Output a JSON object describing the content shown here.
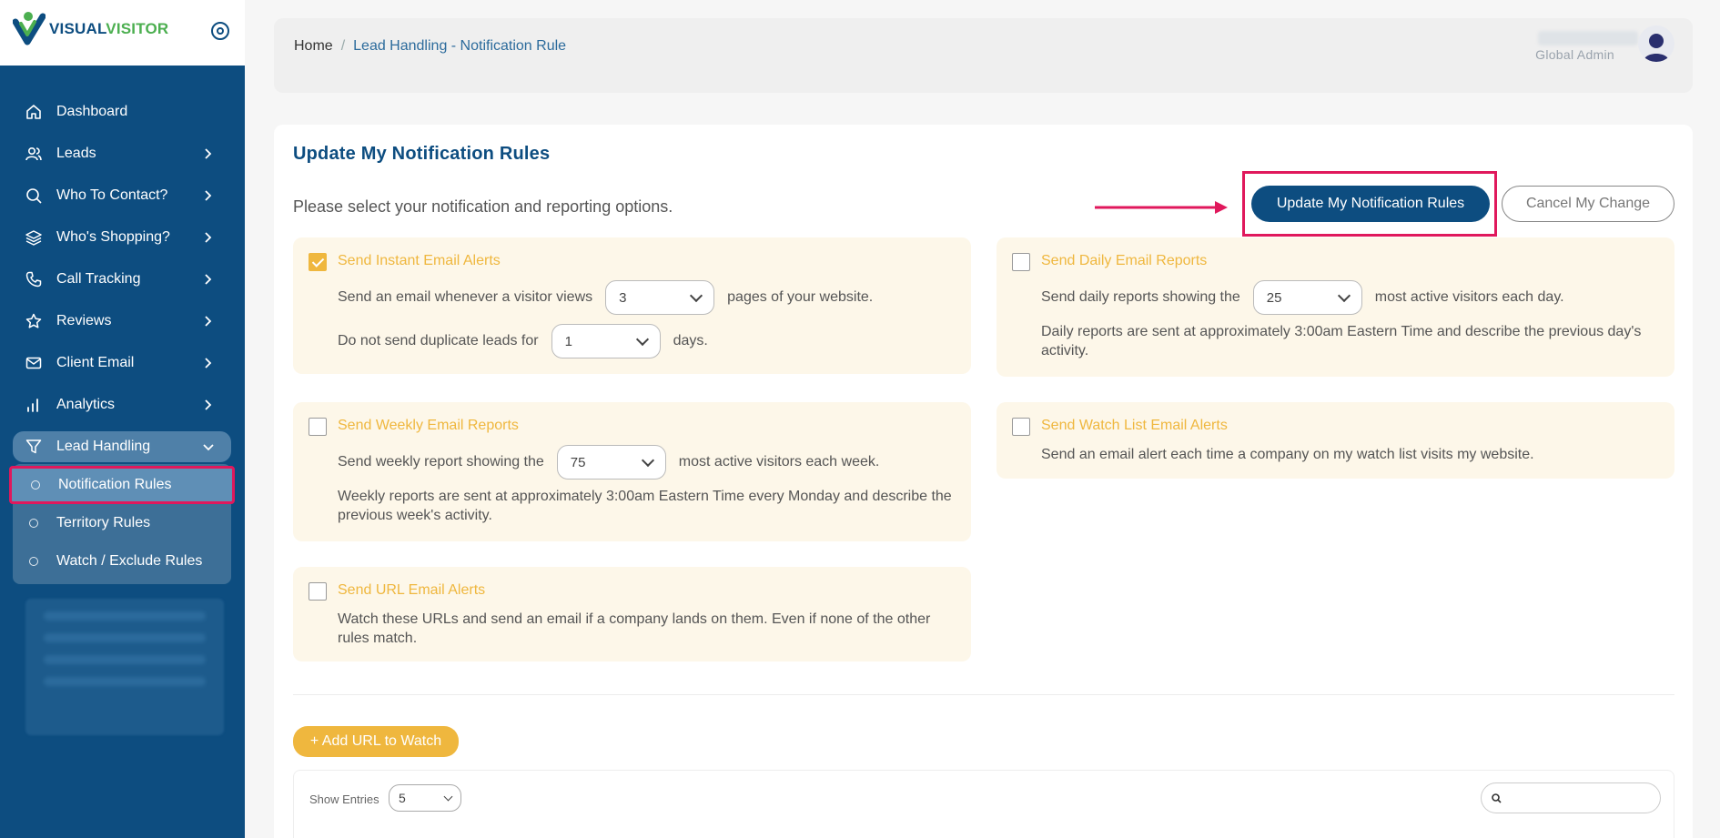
{
  "app": {
    "logo_part1": "VISUAL",
    "logo_part2": "VISITOR"
  },
  "sidebar": {
    "items": [
      {
        "label": "Dashboard",
        "icon": "home-icon"
      },
      {
        "label": "Leads",
        "icon": "users-icon"
      },
      {
        "label": "Who To Contact?",
        "icon": "search-icon"
      },
      {
        "label": "Who's Shopping?",
        "icon": "layers-icon"
      },
      {
        "label": "Call Tracking",
        "icon": "phone-icon"
      },
      {
        "label": "Reviews",
        "icon": "star-icon"
      },
      {
        "label": "Client Email",
        "icon": "mail-icon"
      },
      {
        "label": "Analytics",
        "icon": "bar-chart-icon"
      },
      {
        "label": "Lead Handling",
        "icon": "filter-icon"
      }
    ],
    "sub_items": [
      {
        "label": "Notification Rules"
      },
      {
        "label": "Territory Rules"
      },
      {
        "label": "Watch / Exclude Rules"
      }
    ]
  },
  "header": {
    "breadcrumb_home": "Home",
    "breadcrumb_sep": "/",
    "breadcrumb_current": "Lead Handling - Notification Rule",
    "user_role": "Global Admin"
  },
  "main": {
    "title": "Update My Notification Rules",
    "intro": "Please select your notification and reporting options.",
    "update_button": "Update My Notification Rules",
    "cancel_button": "Cancel My Change",
    "instant": {
      "title": "Send Instant Email Alerts",
      "checked": true,
      "line1_pre": "Send an email whenever a visitor views",
      "line1_value": "3",
      "line1_post": "pages of your website.",
      "line2_pre": "Do not send duplicate leads for",
      "line2_value": "1",
      "line2_post": "days."
    },
    "daily": {
      "title": "Send Daily Email Reports",
      "checked": false,
      "line1_pre": "Send daily reports showing the",
      "line1_value": "25",
      "line1_post": "most active visitors each day.",
      "desc": "Daily reports are sent at approximately 3:00am Eastern Time and describe the previous day's activity."
    },
    "weekly": {
      "title": "Send Weekly Email Reports",
      "checked": false,
      "line1_pre": "Send weekly report showing the",
      "line1_value": "75",
      "line1_post": "most active visitors each week.",
      "desc": "Weekly reports are sent at approximately 3:00am Eastern Time every Monday and describe the previous week's activity."
    },
    "watchlist": {
      "title": "Send Watch List Email Alerts",
      "checked": false,
      "desc": "Send an email alert each time a company on my watch list visits my website."
    },
    "url": {
      "title": "Send URL Email Alerts",
      "checked": false,
      "desc": "Watch these URLs and send an email if a company lands on them. Even if none of the other rules match."
    },
    "add_url_button": "+ Add URL to Watch",
    "table": {
      "show_entries_label": "Show Entries",
      "show_entries_value": "5",
      "search_placeholder": ""
    }
  },
  "colors": {
    "sidebar": "#0d4d80",
    "accent_yellow": "#efb73e",
    "highlight": "#e0185c",
    "panel_bg": "#fdf7e9"
  }
}
